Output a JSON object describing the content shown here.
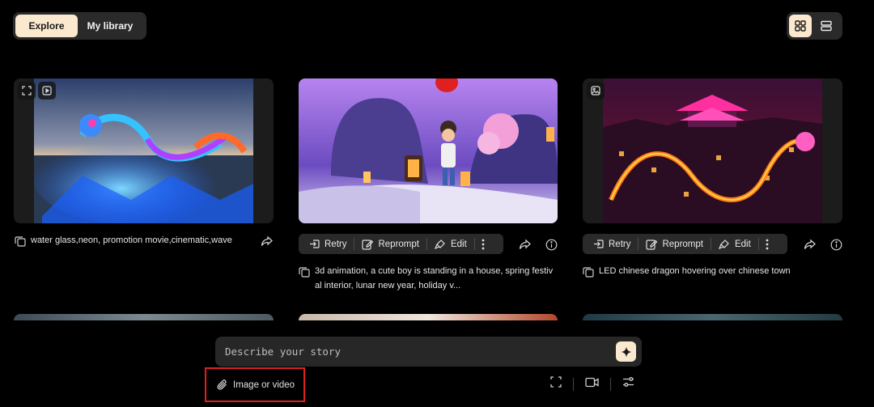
{
  "tabs": {
    "explore": "Explore",
    "library": "My library"
  },
  "view_toggle": {
    "grid": "grid-view-icon",
    "list": "list-view-icon",
    "selected": "grid"
  },
  "cards": [
    {
      "prompt": "water glass,neon, promotion movie,cinematic,wave",
      "media": "video",
      "theme": "neon glass dragon on ocean wave"
    },
    {
      "prompt": "3d animation, a cute boy is standing in a house, spring festival interior, lunar new year, holiday v...",
      "prompt_line1": "3d animation, a cute boy is standing in a house, spring festiv",
      "prompt_line2": "al interior, lunar new year, holiday v...",
      "theme": "3d boy with lanterns purple"
    },
    {
      "prompt": "LED chinese dragon hovering over chinese town",
      "media": "image",
      "theme": "LED dragon over chinese town at night"
    }
  ],
  "actions": {
    "retry": "Retry",
    "reprompt": "Reprompt",
    "edit": "Edit"
  },
  "composer": {
    "placeholder": "Describe your story",
    "attach_label": "Image or video"
  },
  "colors": {
    "accent": "#fbe9cf",
    "panel": "#2a2a2a",
    "highlight": "#e02020"
  }
}
